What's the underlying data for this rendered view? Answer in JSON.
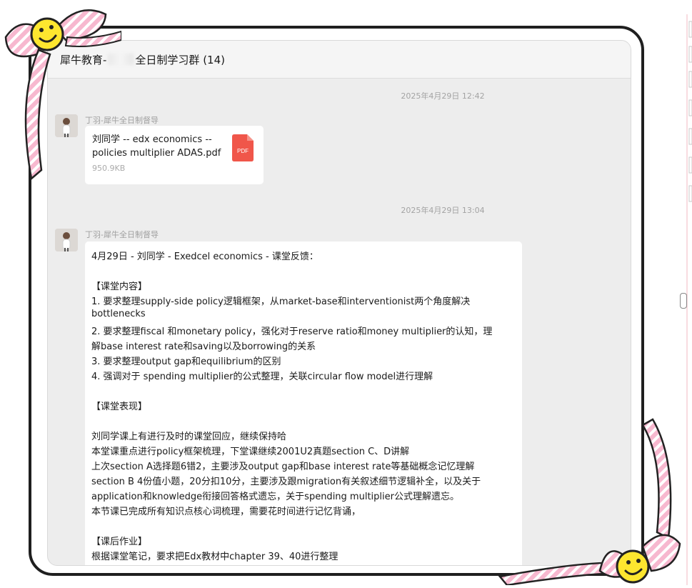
{
  "chat": {
    "title_prefix": "犀牛教育-",
    "title_suffix": "全日制学习群 (14)",
    "timestamps": [
      "2025年4月29日 12:42",
      "2025年4月29日 13:04"
    ],
    "messages": [
      {
        "sender": "丁羽-犀牛全日制督导",
        "file": {
          "name_line1": "刘同学 -- edx economics --",
          "name_line2": "policies multiplier ADAS.pdf",
          "size": "950.9KB",
          "type_label": "PDF"
        }
      },
      {
        "sender": "丁羽-犀牛全日制督导",
        "lines": [
          "4月29日 - 刘同学 - Exedcel economics - 课堂反馈：",
          "",
          "【课堂内容】",
          "1. 要求整理supply-side policy逻辑框架，从market-base和interventionist两个角度解决",
          "bottlenecks",
          "2. 要求整理fiscal 和monetary policy，强化对于reserve ratio和money multiplier的认知，理",
          "解base interest rate和saving以及borrowing的关系",
          "3. 要求整理output gap和equilibrium的区别",
          "4. 强调对于 spending multiplier的公式整理，关联circular flow model进行理解",
          "",
          "【课堂表现】",
          "",
          "刘同学课上有进行及时的课堂回应，继续保持哈",
          "本堂课重点进行policy框架梳理，下堂课继续2001U2真题section C、D讲解",
          "上次section A选择题6错2，主要涉及output gap和base interest rate等基础概念记忆理解",
          "section B 4份值小题，20分扣10分，主要涉及跟migration有关叙述细节逻辑补全，以及关于",
          "application和knowledge衔接回答格式遗忘，关于spending multiplier公式理解遗忘。",
          "本节课已完成所有知识点核心词梳理，需要花时间进行记忆背诵，",
          "",
          "【课后作业】",
          "根据课堂笔记，要求把Edx教材中chapter 39、40进行整理"
        ]
      }
    ]
  },
  "colors": {
    "chat_bg": "#ededed",
    "bubble_bg": "#ffffff",
    "pdf_red": "#f0564a",
    "ribbon_pink": "#f7b8cf",
    "smiley_yellow": "#fde62f"
  }
}
